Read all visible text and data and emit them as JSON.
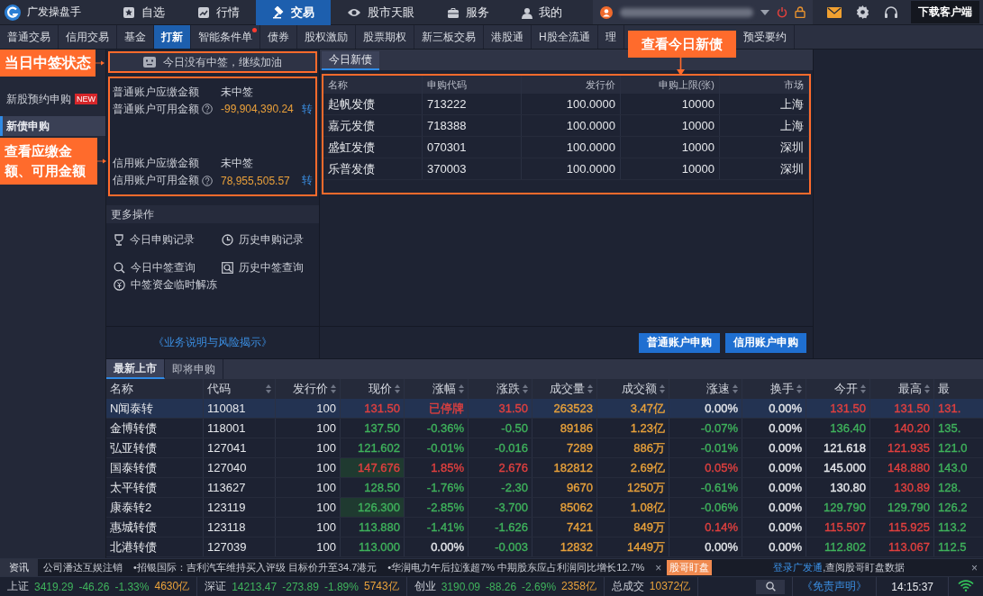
{
  "app": {
    "name": "广发操盘手"
  },
  "nav": [
    {
      "label": "自选",
      "selected": false
    },
    {
      "label": "行情",
      "selected": false
    },
    {
      "label": "交易",
      "selected": true
    },
    {
      "label": "股市天眼",
      "selected": false
    },
    {
      "label": "服务",
      "selected": false
    },
    {
      "label": "我的",
      "selected": false
    }
  ],
  "download_button": "下载客户端",
  "subtabs": [
    {
      "label": "普通交易",
      "selected": false,
      "dot": false
    },
    {
      "label": "信用交易",
      "selected": false,
      "dot": false
    },
    {
      "label": "基金",
      "selected": false,
      "dot": false
    },
    {
      "label": "打新",
      "selected": true,
      "dot": false
    },
    {
      "label": "智能条件单",
      "selected": false,
      "dot": true
    },
    {
      "label": "债券",
      "selected": false,
      "dot": false
    },
    {
      "label": "股权激励",
      "selected": false,
      "dot": false
    },
    {
      "label": "股票期权",
      "selected": false,
      "dot": false
    },
    {
      "label": "新三板交易",
      "selected": false,
      "dot": false
    },
    {
      "label": "港股通",
      "selected": false,
      "dot": false
    },
    {
      "label": "H股全流通",
      "selected": false,
      "dot": false
    },
    {
      "label": "理",
      "selected": false,
      "dot": false
    },
    {
      "label": "预受要约",
      "selected": false,
      "dot": false
    }
  ],
  "callouts": [
    {
      "text": "当日中签状态"
    },
    {
      "text": "查看应缴金额、可用金额"
    },
    {
      "text": "查看今日新债"
    }
  ],
  "sidebar": [
    {
      "label": "新股预约申购",
      "badge": "NEW",
      "selected": false
    },
    {
      "label": "新债申购",
      "selected": true
    }
  ],
  "lottery": {
    "status": "今日没有中签，继续加油",
    "accounts": [
      {
        "due_label": "普通账户应缴金额",
        "due_value": "未中签",
        "avail_label": "普通账户可用金额",
        "avail_value": "-99,904,390.24",
        "transfer": "转"
      },
      {
        "due_label": "信用账户应缴金额",
        "due_value": "未中签",
        "avail_label": "信用账户可用金额",
        "avail_value": "78,955,505.57",
        "transfer": "转"
      }
    ]
  },
  "more_ops": {
    "title": "更多操作",
    "items": [
      "今日申购记录",
      "历史申购记录",
      "今日中签查询",
      "历史中签查询",
      "中签资金临时解冻"
    ]
  },
  "risk_link": "《业务说明与风险揭示》",
  "new_bonds": {
    "tab": "今日新债",
    "columns": [
      "名称",
      "申购代码",
      "发行价",
      "申购上限(张)",
      "市场"
    ],
    "rows": [
      [
        "起帆发债",
        "713222",
        "100.0000",
        "10000",
        "上海"
      ],
      [
        "嘉元发债",
        "718388",
        "100.0000",
        "10000",
        "上海"
      ],
      [
        "盛虹发债",
        "070301",
        "100.0000",
        "10000",
        "深圳"
      ],
      [
        "乐普发债",
        "370003",
        "100.0000",
        "10000",
        "深圳"
      ]
    ],
    "buttons": [
      "普通账户申购",
      "信用账户申购"
    ]
  },
  "listing": {
    "tabs": [
      {
        "label": "最新上市",
        "selected": true
      },
      {
        "label": "即将申购",
        "selected": false
      }
    ],
    "columns": [
      {
        "label": "名称",
        "sortable": false
      },
      {
        "label": "代码",
        "sortable": true
      },
      {
        "label": "发行价",
        "sortable": true
      },
      {
        "label": "现价",
        "sortable": true
      },
      {
        "label": "涨幅",
        "sortable": true
      },
      {
        "label": "涨跌",
        "sortable": true
      },
      {
        "label": "成交量",
        "sortable": true
      },
      {
        "label": "成交额",
        "sortable": true
      },
      {
        "label": "涨速",
        "sortable": true
      },
      {
        "label": "换手",
        "sortable": true
      },
      {
        "label": "今开",
        "sortable": true
      },
      {
        "label": "最高",
        "sortable": true
      },
      {
        "label": "最",
        "sortable": false
      }
    ],
    "rows": [
      {
        "selected": true,
        "price_flash": false,
        "cells": [
          {
            "text": "N闻泰转"
          },
          {
            "text": "110081"
          },
          {
            "text": "100"
          },
          {
            "text": "131.50",
            "color": "#e2403f"
          },
          {
            "text": "已停牌",
            "color": "#e2403f"
          },
          {
            "text": "31.50",
            "color": "#e2403f"
          },
          {
            "text": "263523",
            "color": "#e9a23b"
          },
          {
            "text": "3.47亿",
            "color": "#e9a23b"
          },
          {
            "text": "0.00%",
            "color": "#e6e8ec"
          },
          {
            "text": "0.00%",
            "color": "#e6e8ec"
          },
          {
            "text": "131.50",
            "color": "#e2403f"
          },
          {
            "text": "131.50",
            "color": "#e2403f"
          },
          {
            "text": "131.",
            "color": "#e2403f"
          }
        ]
      },
      {
        "selected": false,
        "price_flash": false,
        "cells": [
          {
            "text": "金博转债"
          },
          {
            "text": "118001"
          },
          {
            "text": "100"
          },
          {
            "text": "137.50",
            "color": "#3fb35c"
          },
          {
            "text": "-0.36%",
            "color": "#3fb35c"
          },
          {
            "text": "-0.50",
            "color": "#3fb35c"
          },
          {
            "text": "89186",
            "color": "#e9a23b"
          },
          {
            "text": "1.23亿",
            "color": "#e9a23b"
          },
          {
            "text": "-0.07%",
            "color": "#3fb35c"
          },
          {
            "text": "0.00%",
            "color": "#e6e8ec"
          },
          {
            "text": "136.40",
            "color": "#3fb35c"
          },
          {
            "text": "140.20",
            "color": "#e2403f"
          },
          {
            "text": "135.",
            "color": "#3fb35c"
          }
        ]
      },
      {
        "selected": false,
        "price_flash": false,
        "cells": [
          {
            "text": "弘亚转债"
          },
          {
            "text": "127041"
          },
          {
            "text": "100"
          },
          {
            "text": "121.602",
            "color": "#3fb35c"
          },
          {
            "text": "-0.01%",
            "color": "#3fb35c"
          },
          {
            "text": "-0.016",
            "color": "#3fb35c"
          },
          {
            "text": "7289",
            "color": "#e9a23b"
          },
          {
            "text": "886万",
            "color": "#e9a23b"
          },
          {
            "text": "-0.01%",
            "color": "#3fb35c"
          },
          {
            "text": "0.00%",
            "color": "#e6e8ec"
          },
          {
            "text": "121.618",
            "color": "#e6e8ec"
          },
          {
            "text": "121.935",
            "color": "#e2403f"
          },
          {
            "text": "121.0",
            "color": "#3fb35c"
          }
        ]
      },
      {
        "selected": false,
        "price_flash": true,
        "cells": [
          {
            "text": "国泰转债"
          },
          {
            "text": "127040"
          },
          {
            "text": "100"
          },
          {
            "text": "147.676",
            "color": "#e2403f"
          },
          {
            "text": "1.85%",
            "color": "#e2403f"
          },
          {
            "text": "2.676",
            "color": "#e2403f"
          },
          {
            "text": "182812",
            "color": "#e9a23b"
          },
          {
            "text": "2.69亿",
            "color": "#e9a23b"
          },
          {
            "text": "0.05%",
            "color": "#e2403f"
          },
          {
            "text": "0.00%",
            "color": "#e6e8ec"
          },
          {
            "text": "145.000",
            "color": "#e6e8ec"
          },
          {
            "text": "148.880",
            "color": "#e2403f"
          },
          {
            "text": "143.0",
            "color": "#3fb35c"
          }
        ]
      },
      {
        "selected": false,
        "price_flash": false,
        "cells": [
          {
            "text": "太平转债"
          },
          {
            "text": "113627"
          },
          {
            "text": "100"
          },
          {
            "text": "128.50",
            "color": "#3fb35c"
          },
          {
            "text": "-1.76%",
            "color": "#3fb35c"
          },
          {
            "text": "-2.30",
            "color": "#3fb35c"
          },
          {
            "text": "9670",
            "color": "#e9a23b"
          },
          {
            "text": "1250万",
            "color": "#e9a23b"
          },
          {
            "text": "-0.61%",
            "color": "#3fb35c"
          },
          {
            "text": "0.00%",
            "color": "#e6e8ec"
          },
          {
            "text": "130.80",
            "color": "#e6e8ec"
          },
          {
            "text": "130.89",
            "color": "#e2403f"
          },
          {
            "text": "128.",
            "color": "#3fb35c"
          }
        ]
      },
      {
        "selected": false,
        "price_flash": true,
        "cells": [
          {
            "text": "康泰转2"
          },
          {
            "text": "123119"
          },
          {
            "text": "100"
          },
          {
            "text": "126.300",
            "color": "#3fb35c"
          },
          {
            "text": "-2.85%",
            "color": "#3fb35c"
          },
          {
            "text": "-3.700",
            "color": "#3fb35c"
          },
          {
            "text": "85062",
            "color": "#e9a23b"
          },
          {
            "text": "1.08亿",
            "color": "#e9a23b"
          },
          {
            "text": "-0.06%",
            "color": "#3fb35c"
          },
          {
            "text": "0.00%",
            "color": "#e6e8ec"
          },
          {
            "text": "129.790",
            "color": "#3fb35c"
          },
          {
            "text": "129.790",
            "color": "#3fb35c"
          },
          {
            "text": "126.2",
            "color": "#3fb35c"
          }
        ]
      },
      {
        "selected": false,
        "price_flash": false,
        "cells": [
          {
            "text": "惠城转债"
          },
          {
            "text": "123118"
          },
          {
            "text": "100"
          },
          {
            "text": "113.880",
            "color": "#3fb35c"
          },
          {
            "text": "-1.41%",
            "color": "#3fb35c"
          },
          {
            "text": "-1.626",
            "color": "#3fb35c"
          },
          {
            "text": "7421",
            "color": "#e9a23b"
          },
          {
            "text": "849万",
            "color": "#e9a23b"
          },
          {
            "text": "0.14%",
            "color": "#e2403f"
          },
          {
            "text": "0.00%",
            "color": "#e6e8ec"
          },
          {
            "text": "115.507",
            "color": "#e2403f"
          },
          {
            "text": "115.925",
            "color": "#e2403f"
          },
          {
            "text": "113.2",
            "color": "#3fb35c"
          }
        ]
      },
      {
        "selected": false,
        "price_flash": false,
        "cells": [
          {
            "text": "北港转债"
          },
          {
            "text": "127039"
          },
          {
            "text": "100"
          },
          {
            "text": "113.000",
            "color": "#3fb35c"
          },
          {
            "text": "0.00%",
            "color": "#e6e8ec"
          },
          {
            "text": "-0.003",
            "color": "#3fb35c"
          },
          {
            "text": "12832",
            "color": "#e9a23b"
          },
          {
            "text": "1449万",
            "color": "#e9a23b"
          },
          {
            "text": "0.00%",
            "color": "#e6e8ec"
          },
          {
            "text": "0.00%",
            "color": "#e6e8ec"
          },
          {
            "text": "112.802",
            "color": "#3fb35c"
          },
          {
            "text": "113.067",
            "color": "#e2403f"
          },
          {
            "text": "112.5",
            "color": "#3fb35c"
          }
        ]
      }
    ]
  },
  "ticker": {
    "label": "资讯",
    "items": [
      "公司潘达互娱注销",
      "•招银国际：吉利汽车维持买入评级 目标价升至34.7港元",
      "•华润电力午后拉涨超7% 中期股东应占利润同比增长12.7%"
    ],
    "close": "×",
    "badge": "股哥盯盘",
    "login_link": "登录广发通",
    "login_text": ",查阅股哥盯盘数据",
    "close2": "×"
  },
  "status_bar": {
    "indices": [
      {
        "name": "上证",
        "value": "3419.29",
        "change": "-46.26",
        "pct": "-1.33%",
        "amount": "4630亿",
        "color": "#3fb35c"
      },
      {
        "name": "深证",
        "value": "14213.47",
        "change": "-273.89",
        "pct": "-1.89%",
        "amount": "5743亿",
        "color": "#3fb35c"
      },
      {
        "name": "创业",
        "value": "3190.09",
        "change": "-88.26",
        "pct": "-2.69%",
        "amount": "2358亿",
        "color": "#3fb35c"
      }
    ],
    "total_label": "总成交",
    "total_value": "10372亿",
    "disclaimer": "《免责声明》",
    "time": "14:15:37"
  }
}
